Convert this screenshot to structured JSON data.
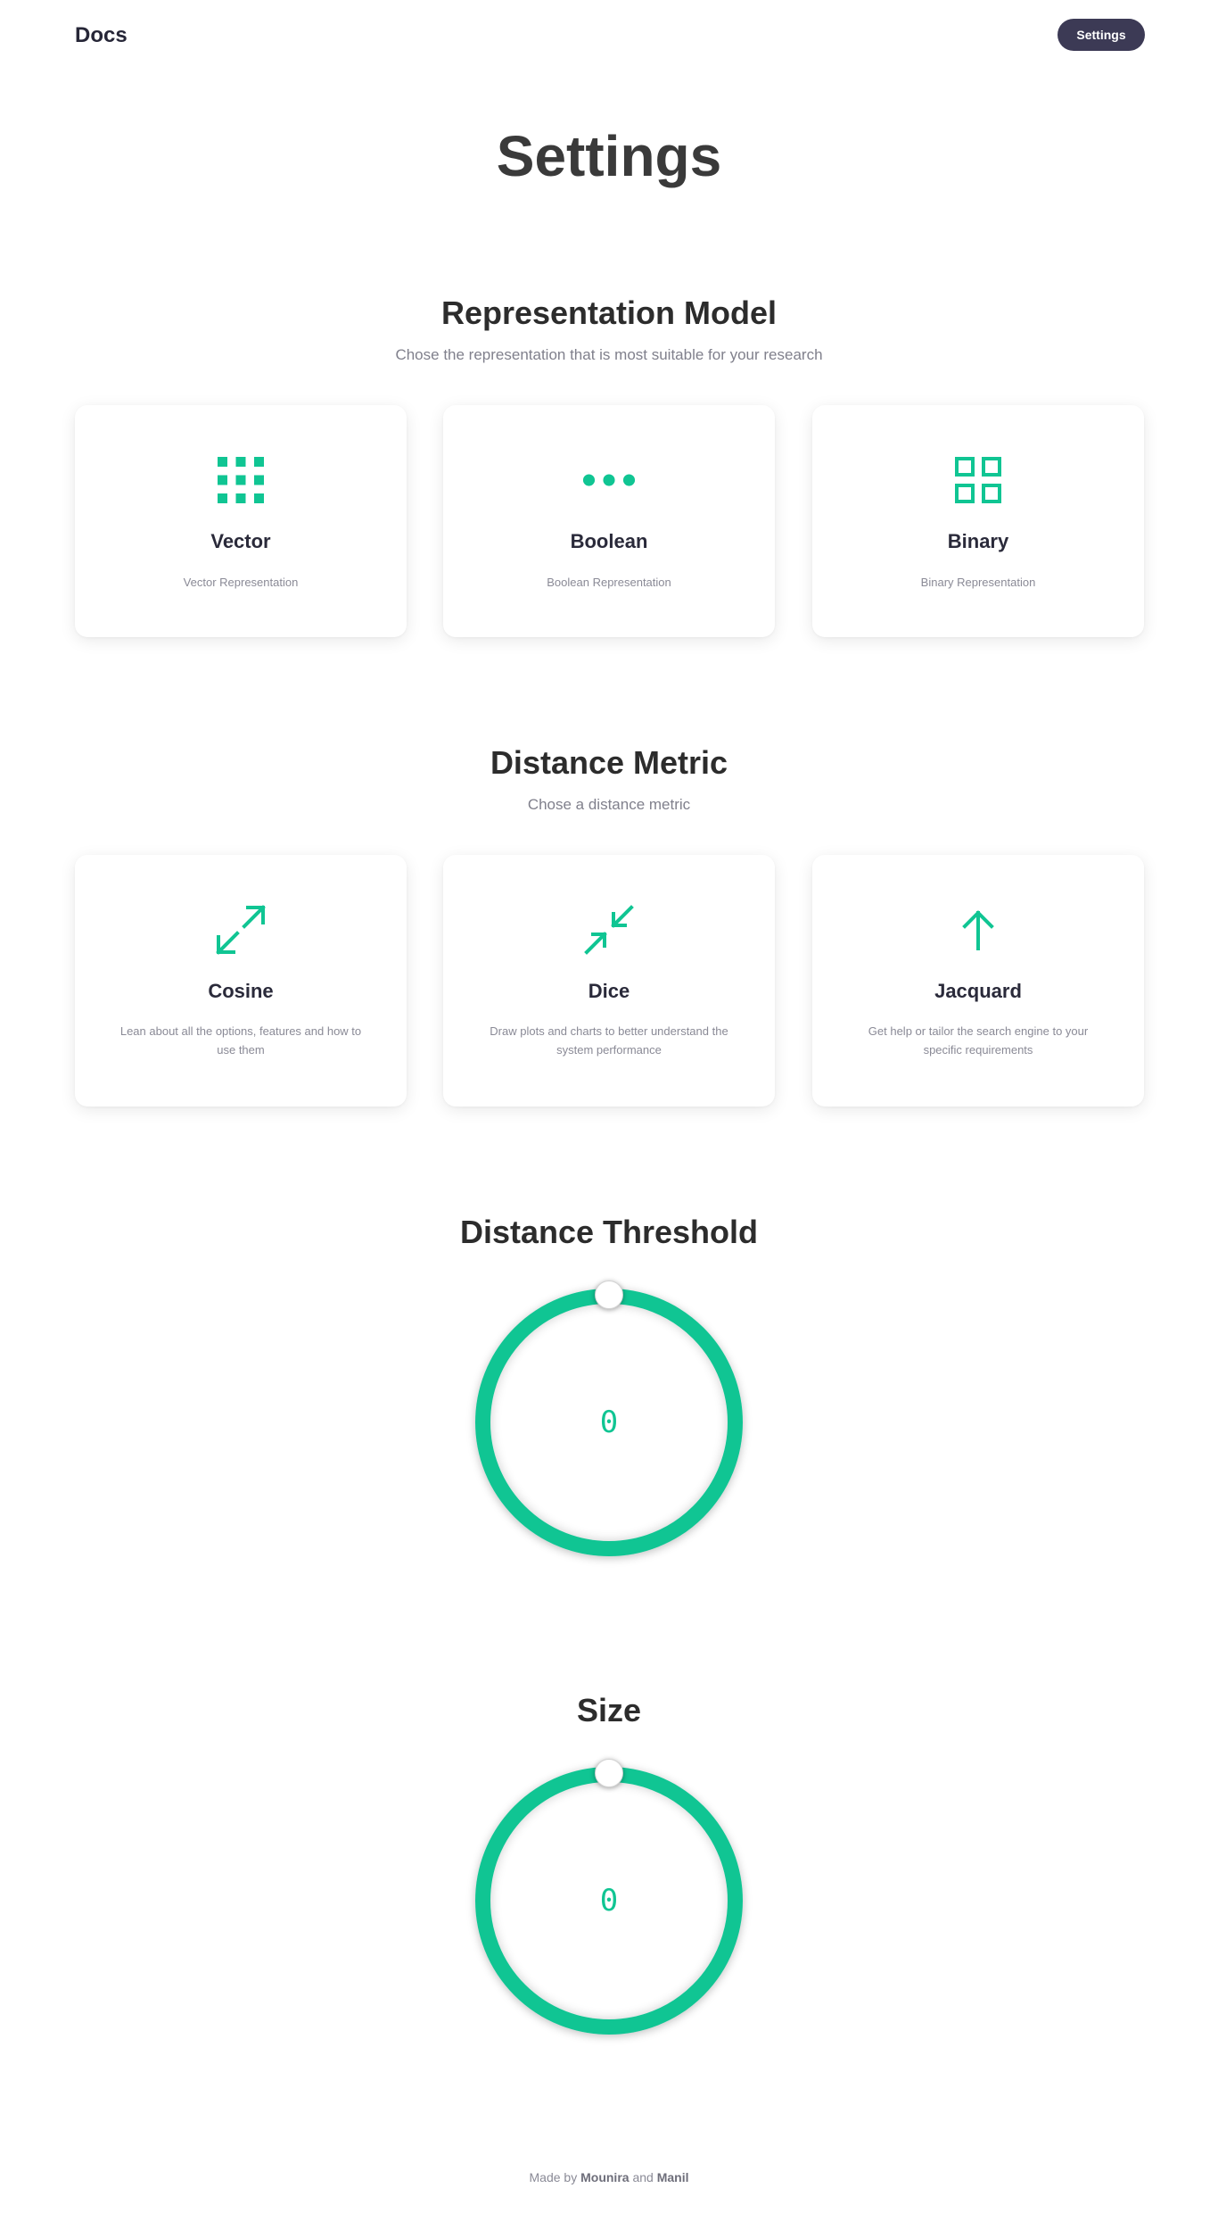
{
  "header": {
    "brand": "Docs",
    "settings_button": "Settings"
  },
  "page": {
    "title": "Settings"
  },
  "representation": {
    "title": "Representation Model",
    "subtitle": "Chose the representation that is most suitable for your research",
    "cards": [
      {
        "icon": "grid-dots-icon",
        "title": "Vector",
        "description": "Vector Representation"
      },
      {
        "icon": "ellipsis-icon",
        "title": "Boolean",
        "description": "Boolean Representation"
      },
      {
        "icon": "squares-grid-icon",
        "title": "Binary",
        "description": "Binary Representation"
      }
    ]
  },
  "distance_metric": {
    "title": "Distance Metric",
    "subtitle": "Chose a distance metric",
    "cards": [
      {
        "icon": "expand-arrows-icon",
        "title": "Cosine",
        "description": "Lean about all the options, features and how to use them"
      },
      {
        "icon": "collapse-arrows-icon",
        "title": "Dice",
        "description": "Draw plots and charts to better understand the system performance"
      },
      {
        "icon": "arrow-up-icon",
        "title": "Jacquard",
        "description": "Get help or tailor the search engine to your specific requirements"
      }
    ]
  },
  "distance_threshold": {
    "title": "Distance Threshold",
    "value": "0"
  },
  "size": {
    "title": "Size",
    "value": "0"
  },
  "footer": {
    "prefix": "Made by",
    "author1": "Mounira",
    "conjunction": "and",
    "author2": "Manil"
  },
  "colors": {
    "accent": "#10c593",
    "button_bg": "#3c3a55",
    "heading": "#2c2c2c",
    "muted": "#80808c"
  }
}
